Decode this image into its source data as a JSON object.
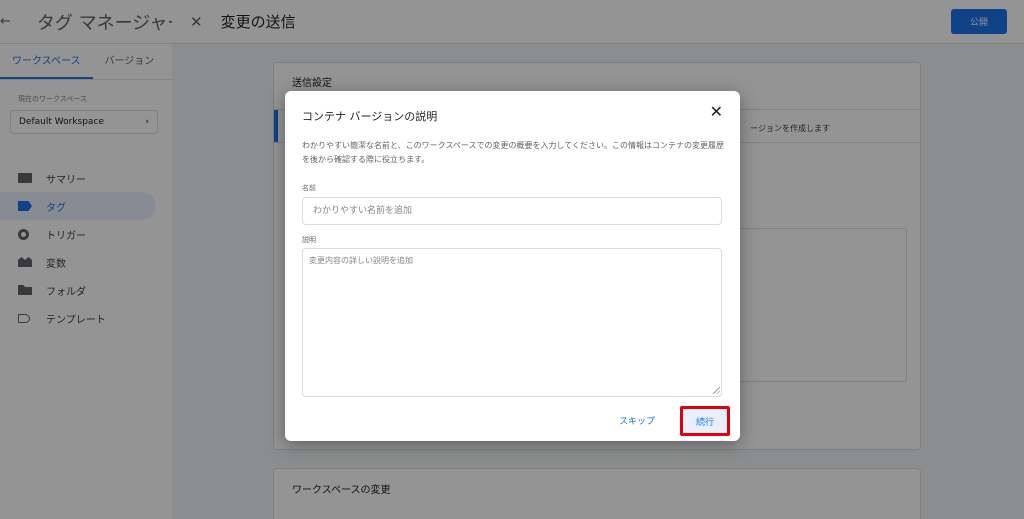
{
  "app": {
    "title": "タグ マネージャー"
  },
  "workspace_tabs": [
    "ワークスペース",
    "バージョン"
  ],
  "sidebar": {
    "current_workspace_label": "現在のワークスペース",
    "workspace_name": "Default Workspace",
    "items": [
      {
        "label": "サマリー",
        "icon": "summary-icon"
      },
      {
        "label": "タグ",
        "icon": "tag-icon"
      },
      {
        "label": "トリガー",
        "icon": "trigger-icon"
      },
      {
        "label": "変数",
        "icon": "variables-icon"
      },
      {
        "label": "フォルダ",
        "icon": "folder-icon"
      },
      {
        "label": "テンプレート",
        "icon": "template-icon"
      }
    ],
    "active_index": 1
  },
  "panel": {
    "title": "変更の送信",
    "publish_label": "公開",
    "settings_title": "送信設定",
    "partial_option_text": "ージョンを作成します",
    "changes_title": "ワークスペースの変更"
  },
  "dialog": {
    "title": "コンテナ バージョンの説明",
    "description": "わかりやすい簡潔な名前と、このワークスペースでの変更の概要を入力してください。この情報はコンテナの変更履歴を後から確認する際に役立ちます。",
    "name_label": "名前",
    "name_placeholder": "わかりやすい名前を追加",
    "name_value": "",
    "desc_label": "説明",
    "desc_placeholder": "変更内容の詳しい説明を追加",
    "desc_value": "",
    "skip_label": "スキップ",
    "continue_label": "続行"
  },
  "colors": {
    "accent": "#1a73e8",
    "highlight": "#e0000d"
  }
}
